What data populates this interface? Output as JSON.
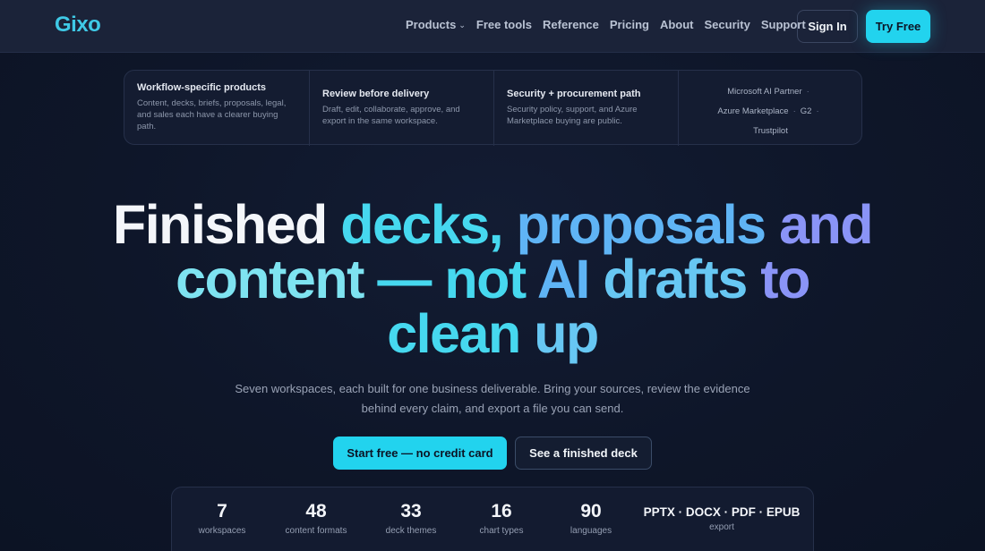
{
  "nav": {
    "logo": "Gixo",
    "links": [
      {
        "label": "Products",
        "has_dropdown": true
      },
      {
        "label": "Free tools"
      },
      {
        "label": "Reference"
      },
      {
        "label": "Pricing"
      },
      {
        "label": "About"
      },
      {
        "label": "Security"
      },
      {
        "label": "Support"
      }
    ],
    "sign_in": "Sign In",
    "try_free": "Try Free"
  },
  "features": [
    {
      "title": "Workflow-specific products",
      "desc": "Content, decks, briefs, proposals, legal, and sales each have a clearer buying path."
    },
    {
      "title": "Review before delivery",
      "desc": "Draft, edit, collaborate, approve, and export in the same workspace."
    },
    {
      "title": "Security + procurement path",
      "desc": "Security policy, support, and Azure Marketplace buying are public."
    }
  ],
  "badges": [
    "Microsoft AI Partner",
    "Azure Marketplace",
    "G2",
    "Trustpilot"
  ],
  "badge_separator": "·",
  "hero": {
    "title_parts": [
      "Finished",
      "decks,",
      "proposals",
      "and",
      "content",
      "—",
      "not",
      "AI",
      "drafts",
      "to",
      "clean",
      "up"
    ],
    "subtitle": "Seven workspaces, each built for one business deliverable. Bring your sources, review the evidence behind every claim, and export a file you can send.",
    "cta_primary": "Start free — no credit card",
    "cta_secondary": "See a finished deck"
  },
  "stats": [
    {
      "value": "7",
      "label": "workspaces"
    },
    {
      "value": "48",
      "label": "content formats"
    },
    {
      "value": "33",
      "label": "deck themes"
    },
    {
      "value": "16",
      "label": "chart types"
    },
    {
      "value": "90",
      "label": "languages"
    },
    {
      "value": "PPTX · DOCX · PDF · EPUB",
      "label": "export"
    }
  ],
  "colors": {
    "accent": "#22d3ee",
    "background": "#0f172a",
    "nav_background": "#1b2339"
  },
  "icons": {
    "dropdown": "chevron-down-icon"
  }
}
